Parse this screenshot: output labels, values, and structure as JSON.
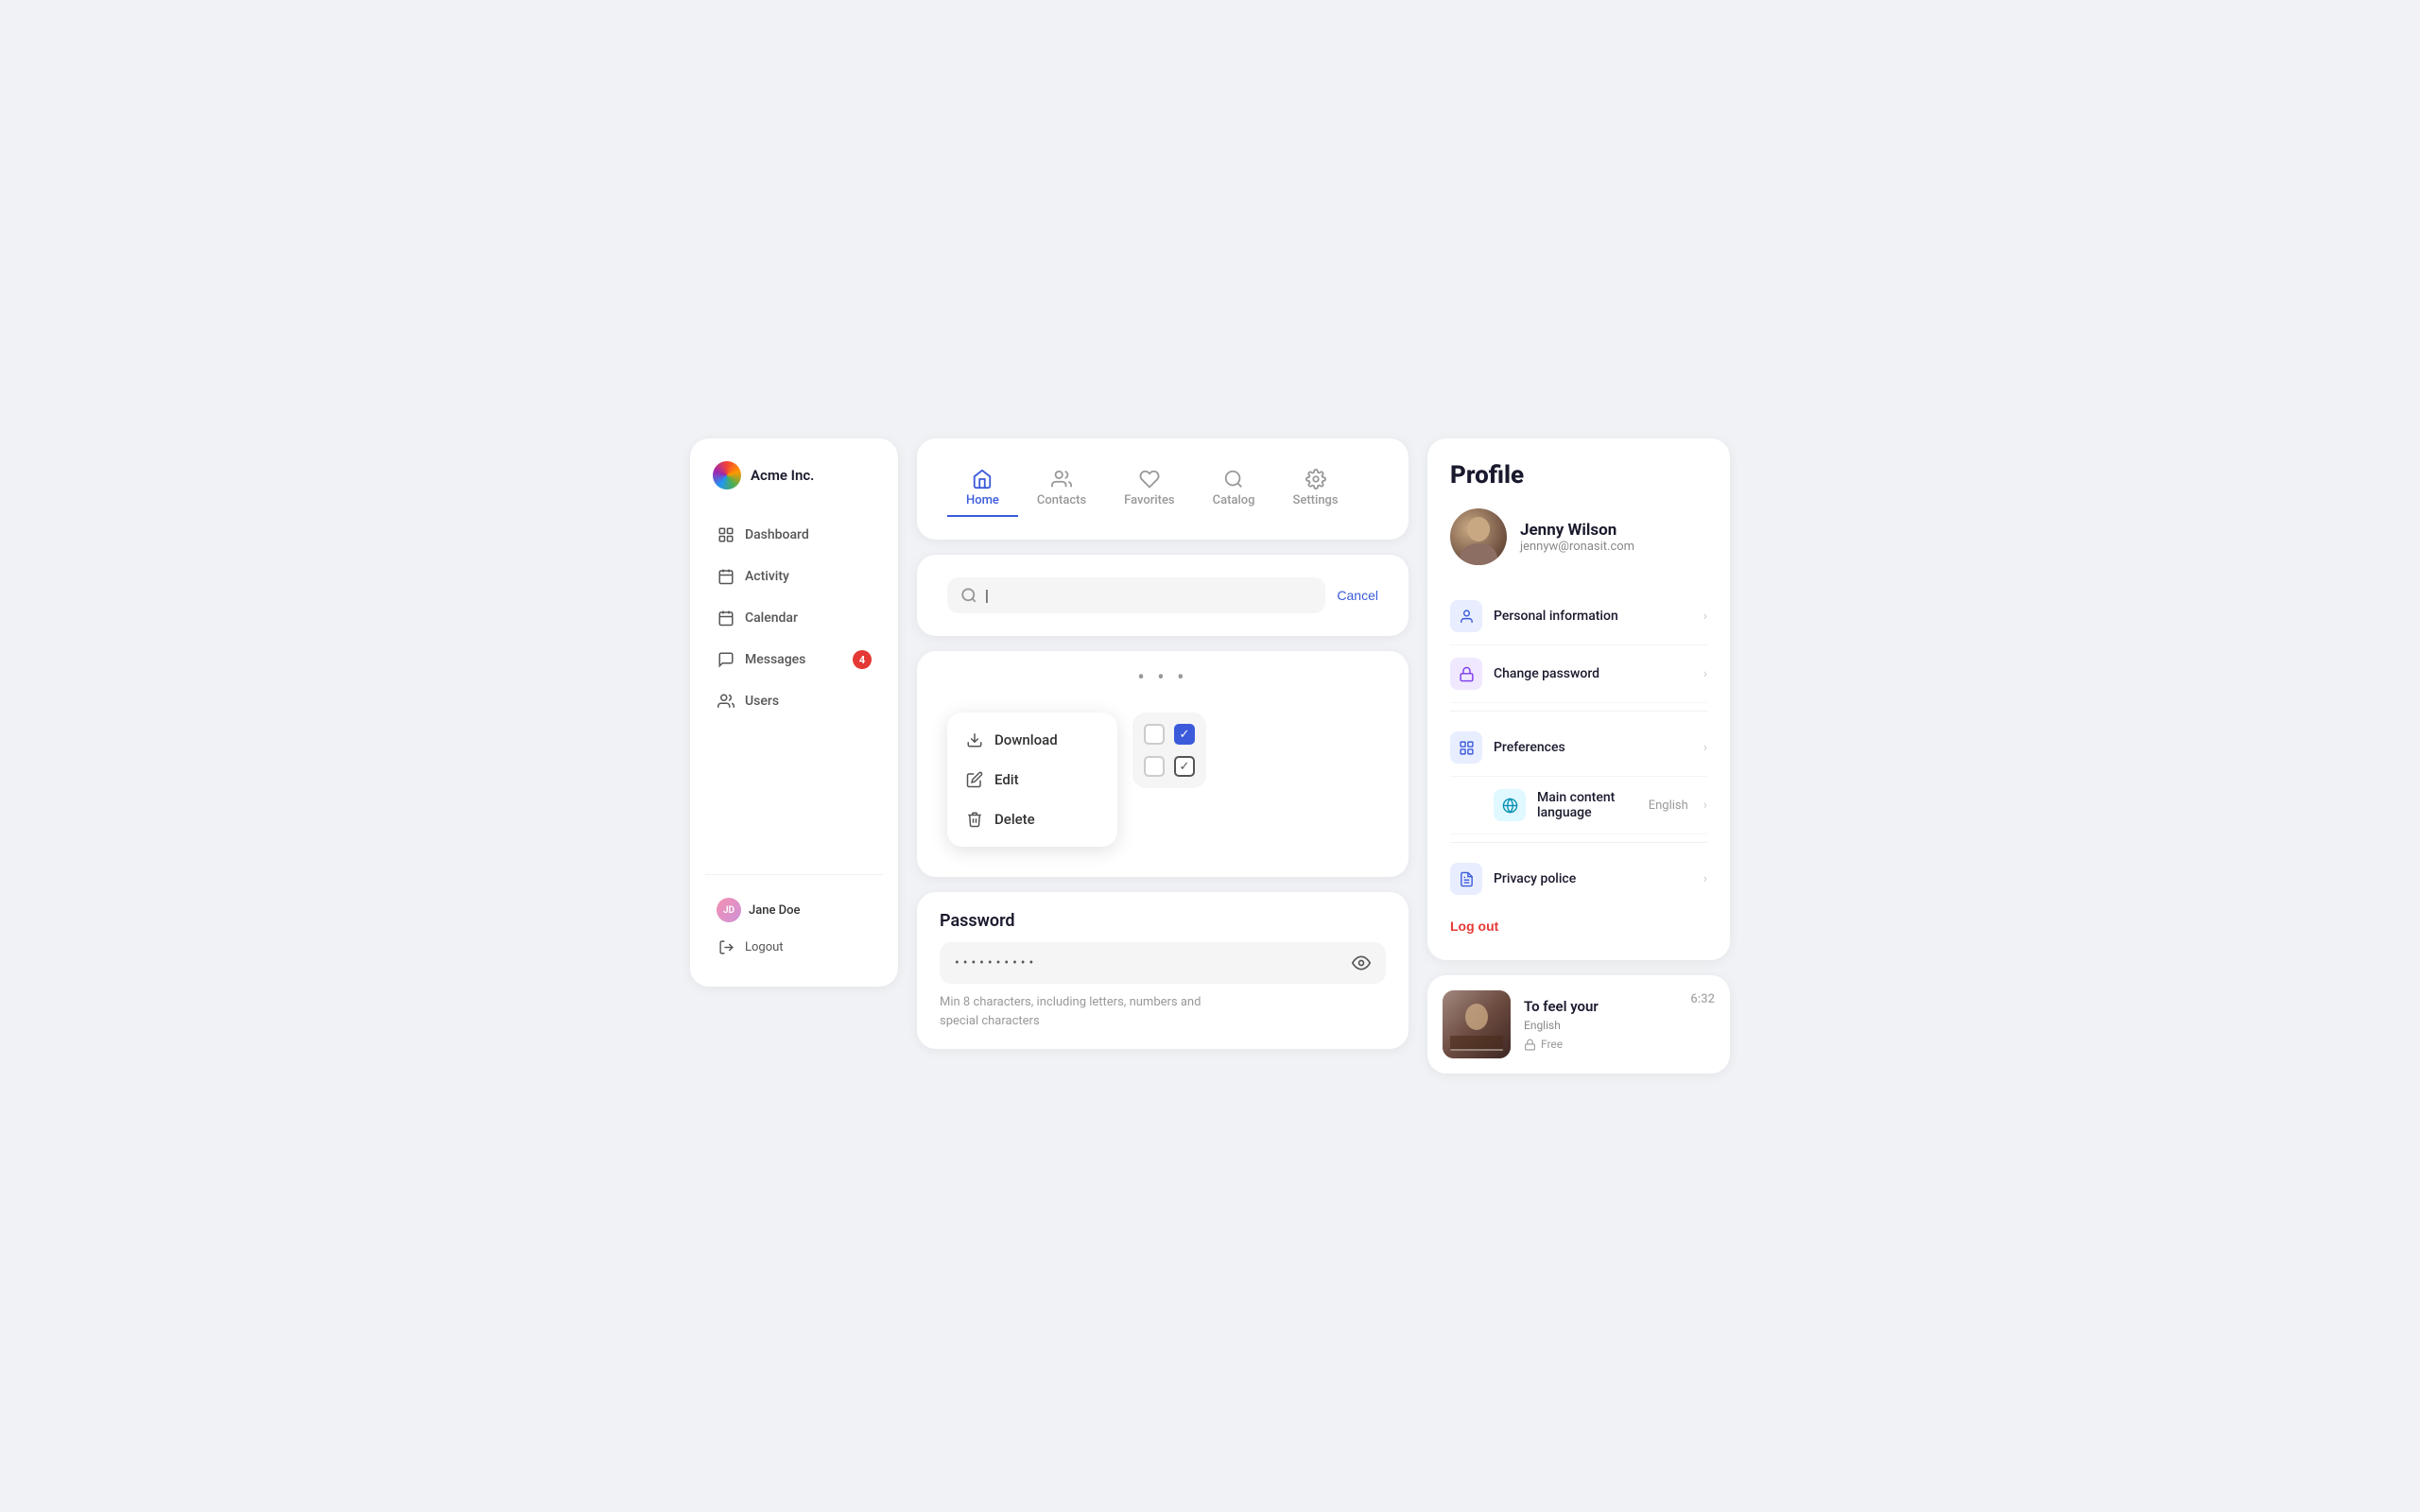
{
  "sidebar": {
    "logo_text": "Acme Inc.",
    "nav_items": [
      {
        "id": "dashboard",
        "label": "Dashboard",
        "active": false
      },
      {
        "id": "activity",
        "label": "Activity",
        "active": false
      },
      {
        "id": "calendar",
        "label": "Calendar",
        "active": false
      },
      {
        "id": "messages",
        "label": "Messages",
        "active": false,
        "badge": "4"
      },
      {
        "id": "users",
        "label": "Users",
        "active": false
      }
    ],
    "user": {
      "name": "Jane Doe"
    },
    "logout_label": "Logout"
  },
  "tabs": [
    {
      "id": "home",
      "label": "Home",
      "active": true
    },
    {
      "id": "contacts",
      "label": "Contacts",
      "active": false
    },
    {
      "id": "favorites",
      "label": "Favorites",
      "active": false
    },
    {
      "id": "catalog",
      "label": "Catalog",
      "active": false
    },
    {
      "id": "settings",
      "label": "Settings",
      "active": false
    }
  ],
  "search": {
    "placeholder": "",
    "value": "|",
    "cancel_label": "Cancel"
  },
  "context_menu": {
    "items": [
      {
        "id": "download",
        "label": "Download"
      },
      {
        "id": "edit",
        "label": "Edit"
      },
      {
        "id": "delete",
        "label": "Delete"
      }
    ]
  },
  "password_section": {
    "label": "Password",
    "value": "••••••••••",
    "hint": "Min 8 characters, including letters, numbers and\nspecial characters"
  },
  "profile": {
    "title": "Profile",
    "user": {
      "name": "Jenny Wilson",
      "email": "jennyw@ronasit.com"
    },
    "menu_items": [
      {
        "id": "personal_info",
        "label": "Personal information",
        "icon_type": "blue"
      },
      {
        "id": "change_password",
        "label": "Change password",
        "icon_type": "purple"
      },
      {
        "id": "preferences",
        "label": "Preferences",
        "icon_type": "blue2",
        "section": true
      },
      {
        "id": "main_content_language",
        "label": "Main content language",
        "icon_type": "cyan",
        "value": "English",
        "sub": true
      },
      {
        "id": "privacy_police",
        "label": "Privacy police",
        "icon_type": "blue2"
      }
    ],
    "logout_label": "Log out"
  },
  "media_card": {
    "title": "To feel your",
    "language": "English",
    "free_label": "Free",
    "duration": "6:32"
  }
}
